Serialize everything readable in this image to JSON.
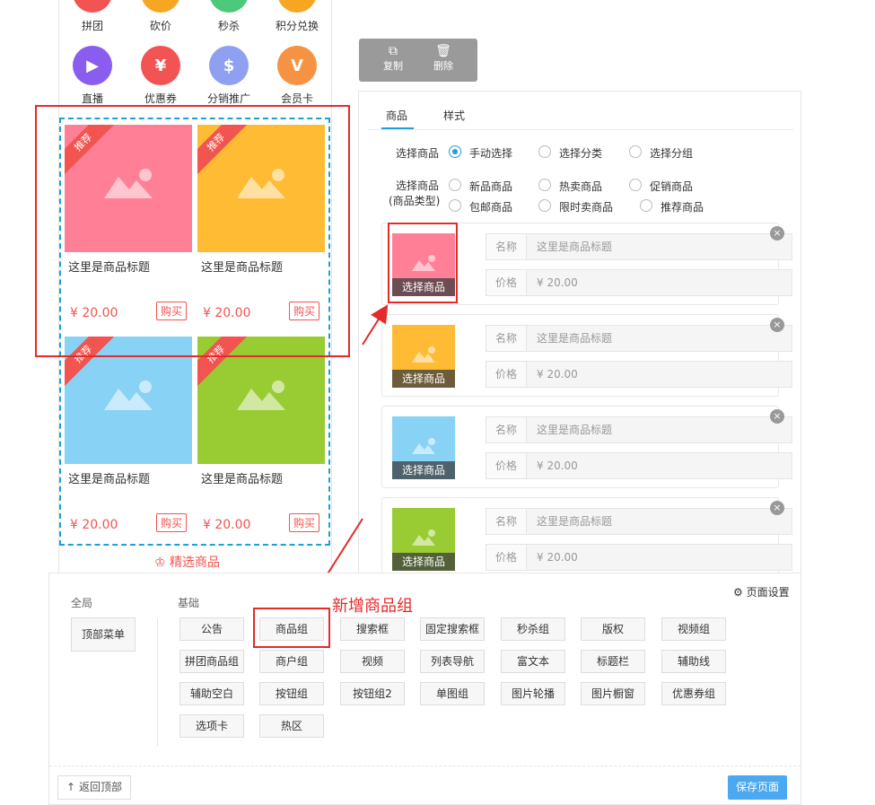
{
  "nav_row1": [
    "拼团",
    "砍价",
    "秒杀",
    "积分兑换"
  ],
  "nav_row2": [
    {
      "label": "直播",
      "color": "#8a5cf0",
      "glyph": "▶"
    },
    {
      "label": "优惠券",
      "color": "#f25454",
      "glyph": "¥"
    },
    {
      "label": "分销推广",
      "color": "#8fa0f0",
      "glyph": "$"
    },
    {
      "label": "会员卡",
      "color": "#f59342",
      "glyph": "V"
    }
  ],
  "goods": [
    {
      "ribbon": "推荐",
      "title": "这里是商品标题",
      "price": "¥ 20.00",
      "buy": "购买",
      "color": "#ff8096"
    },
    {
      "ribbon": "推荐",
      "title": "这里是商品标题",
      "price": "¥ 20.00",
      "buy": "购买",
      "color": "#ffbb33"
    },
    {
      "ribbon": "推荐",
      "title": "这里是商品标题",
      "price": "¥ 20.00",
      "buy": "购买",
      "color": "#88d2f5"
    },
    {
      "ribbon": "推荐",
      "title": "这里是商品标题",
      "price": "¥ 20.00",
      "buy": "购买",
      "color": "#99cc33"
    }
  ],
  "featured_label": "精选商品",
  "toolbar": {
    "copy": "复制",
    "delete": "删除"
  },
  "tabs": [
    "商品",
    "样式"
  ],
  "select_mode": {
    "label": "选择商品",
    "options": [
      "手动选择",
      "选择分类",
      "选择分组"
    ],
    "selected": 0
  },
  "goods_type": {
    "label1": "选择商品",
    "label2": "(商品类型)",
    "options": [
      "新品商品",
      "热卖商品",
      "促销商品",
      "包邮商品",
      "限时卖商品",
      "推荐商品"
    ]
  },
  "items": [
    {
      "thumb_label": "选择商品",
      "name_key": "名称",
      "name_value": "这里是商品标题",
      "price_key": "价格",
      "price_value": "¥ 20.00",
      "color": "#ff8096"
    },
    {
      "thumb_label": "选择商品",
      "name_key": "名称",
      "name_value": "这里是商品标题",
      "price_key": "价格",
      "price_value": "¥ 20.00",
      "color": "#ffbb33"
    },
    {
      "thumb_label": "选择商品",
      "name_key": "名称",
      "name_value": "这里是商品标题",
      "price_key": "价格",
      "price_value": "¥ 20.00",
      "color": "#88d2f5"
    },
    {
      "thumb_label": "选择商品",
      "name_key": "名称",
      "name_value": "这里是商品标题",
      "price_key": "价格",
      "price_value": "¥ 20.00",
      "color": "#99cc33"
    }
  ],
  "bottom": {
    "global_title": "全局",
    "basic_title": "基础",
    "page_settings": "页面设置",
    "top_menu": "顶部菜单",
    "components": [
      [
        "公告",
        "商品组",
        "搜索框",
        "固定搜索框",
        "秒杀组",
        "版权",
        "视频组"
      ],
      [
        "拼团商品组",
        "商户组",
        "视频",
        "列表导航",
        "富文本",
        "标题栏",
        "辅助线"
      ],
      [
        "辅助空白",
        "按钮组",
        "按钮组2",
        "单图组",
        "图片轮播",
        "图片橱窗",
        "优惠券组"
      ],
      [
        "选项卡",
        "热区"
      ]
    ],
    "back_top": "返回顶部",
    "save": "保存页面"
  },
  "annotation": "新增商品组",
  "accent": "#1e9fd8",
  "red": "#e52a2a"
}
